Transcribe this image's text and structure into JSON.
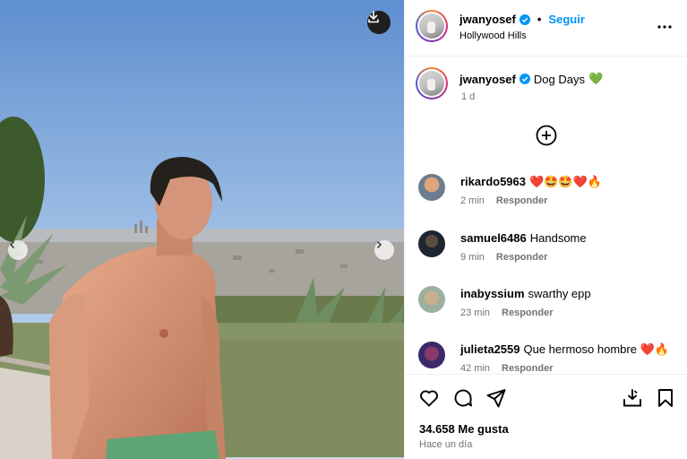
{
  "post": {
    "username": "jwanyosef",
    "follow_label": "Seguir",
    "separator": "•",
    "location": "Hollywood Hills",
    "caption_text": "Dog Days",
    "caption_emoji": "💚",
    "caption_time": "1 d"
  },
  "comments": [
    {
      "user": "rikardo5963",
      "text": "❤️🤩🤩❤️🔥",
      "time": "2 min",
      "reply": "Responder"
    },
    {
      "user": "samuel6486",
      "text": "Handsome",
      "time": "9 min",
      "reply": "Responder"
    },
    {
      "user": "inabyssium",
      "text": "swarthy epp",
      "time": "23 min",
      "reply": "Responder"
    },
    {
      "user": "julieta2559",
      "text": "Que hermoso hombre ❤️🔥",
      "time": "42 min",
      "reply": "Responder"
    }
  ],
  "footer": {
    "likes": "34.658 Me gusta",
    "posted": "Hace un día"
  },
  "icons": {
    "download": "download-icon",
    "prev": "chevron-left-icon",
    "next": "chevron-right-icon",
    "verified": "verified-badge-icon",
    "more": "more-options-icon",
    "add_comment": "plus-circle-icon",
    "like": "heart-icon",
    "comment": "comment-icon",
    "share": "share-icon",
    "save_to_collection": "download-tray-icon",
    "bookmark": "bookmark-icon"
  },
  "colors": {
    "accent": "#0095f6",
    "secondary_text": "#737373",
    "divider": "#efefef"
  }
}
